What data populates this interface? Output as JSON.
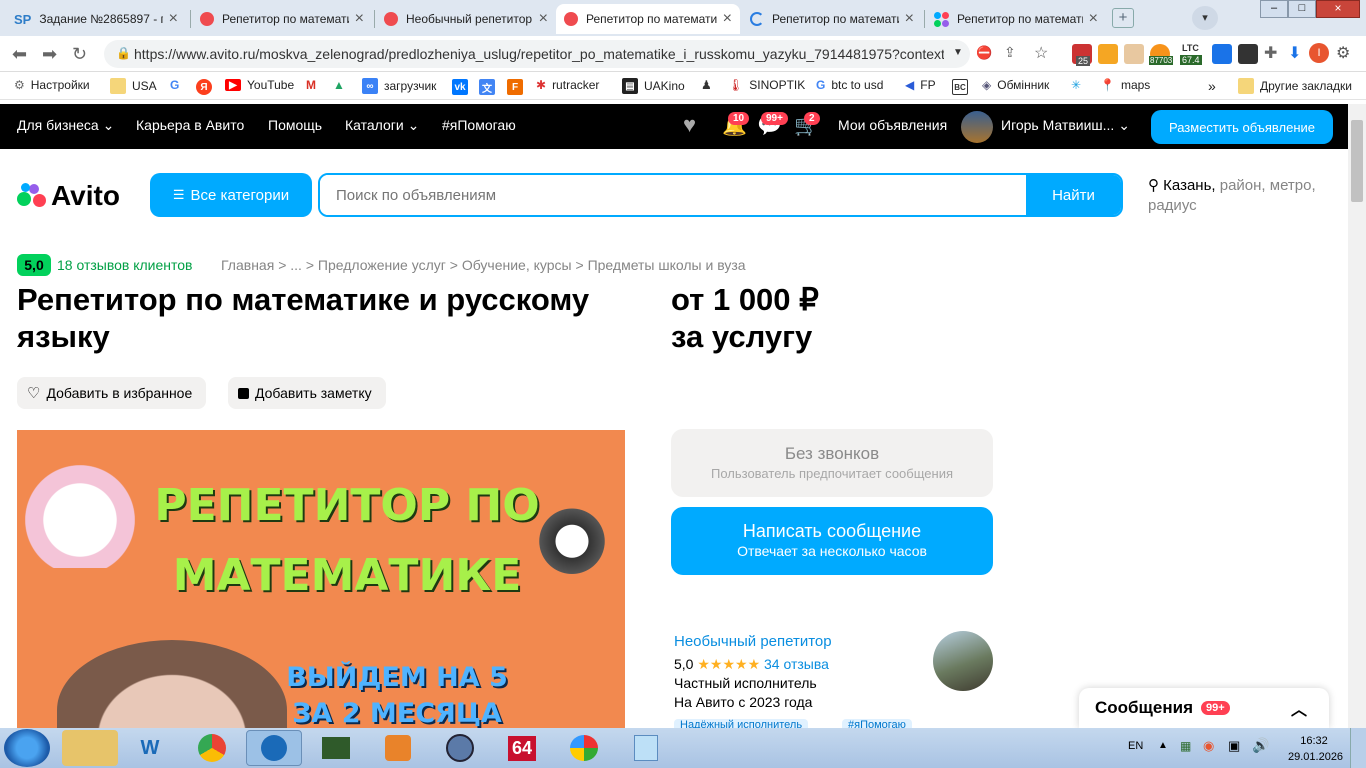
{
  "browser": {
    "tabs": [
      {
        "title": "Задание №2865897 - п",
        "icon": "sp-favicon"
      },
      {
        "title": "Репетитор по математи",
        "icon": "avito-favicon"
      },
      {
        "title": "Необычный репетитор",
        "icon": "avito-favicon"
      },
      {
        "title": "Репетитор по математи",
        "icon": "avito-favicon",
        "active": true
      },
      {
        "title": "Репетитор по математи",
        "icon": "loading-icon"
      },
      {
        "title": "Репетитор по математи",
        "icon": "avito-color-favicon"
      }
    ],
    "url": "https://www.avito.ru/moskva_zelenograd/predlozheniya_uslug/repetitor_po_matematike_i_russkomu_yazyku_7914481975?context...",
    "ext": {
      "ltc_label": "LTC",
      "ltc_value": "67.4",
      "btc_value": "87703",
      "ext_count": "25",
      "profile_letter": "I"
    },
    "bookmarks": [
      "Настройки",
      "USA",
      "YouTube",
      "загрузчик",
      "rutracker",
      "UAKino",
      "SINOPTIK",
      "btc to usd",
      "FP",
      "Обмінник",
      "maps"
    ],
    "bookmarks_more": "»",
    "other_bookmarks": "Другие закладки"
  },
  "topnav": {
    "items": [
      "Для бизнеса",
      "Карьера в Авито",
      "Помощь",
      "Каталоги",
      "#яПомогаю"
    ],
    "badges": {
      "notifications": "10",
      "messages": "99+",
      "cart": "2"
    },
    "my_ads": "Мои объявления",
    "user": "Игорь Матвииш...",
    "post_button": "Разместить объявление"
  },
  "header": {
    "logo": "Avito",
    "categories_button": "Все категории",
    "search_placeholder": "Поиск по объявлениям",
    "search_button": "Найти",
    "location_city": "Казань,",
    "location_rest": " район, метро, радиус"
  },
  "listing": {
    "rating": "5,0",
    "reviews_link": "18 отзывов клиентов",
    "breadcrumbs": [
      "Главная",
      "...",
      "Предложение услуг",
      "Обучение, курсы",
      "Предметы школы и вуза"
    ],
    "breadcrumb_sep": ">",
    "title": "Репетитор по математике и русскому языку",
    "price_line1": "от 1 000 ₽",
    "price_line2": "за услугу",
    "favorite_button": "Добавить в избранное",
    "note_button": "Добавить заметку",
    "photo_text1": "РЕПЕТИТОР ПО",
    "photo_text2": "МАТЕМАТИКЕ",
    "photo_text3": "ВЫЙДЕМ НА 5",
    "photo_text4": "ЗА 2 МЕСЯЦА"
  },
  "contact": {
    "nocall_title": "Без звонков",
    "nocall_sub": "Пользователь предпочитает сообщения",
    "message_title": "Написать сообщение",
    "message_sub": "Отвечает за несколько часов"
  },
  "seller": {
    "name": "Необычный репетитор",
    "rating": "5,0",
    "stars": "★★★★★",
    "reviews": "34 отзыва",
    "type": "Частный исполнитель",
    "since": "На Авито с 2023 года",
    "tags": [
      "Надёжный исполнитель",
      "#яПомогаю"
    ]
  },
  "messages_panel": {
    "title": "Сообщения",
    "badge": "99+"
  },
  "taskbar": {
    "lang": "EN",
    "time": "16:32",
    "date": "29.01.2026",
    "app_64": "64"
  },
  "colors": {
    "accent": "#00aaff",
    "rating_green": "#02d15c",
    "badge_red": "#ff4053",
    "nav_bg": "#000000"
  }
}
